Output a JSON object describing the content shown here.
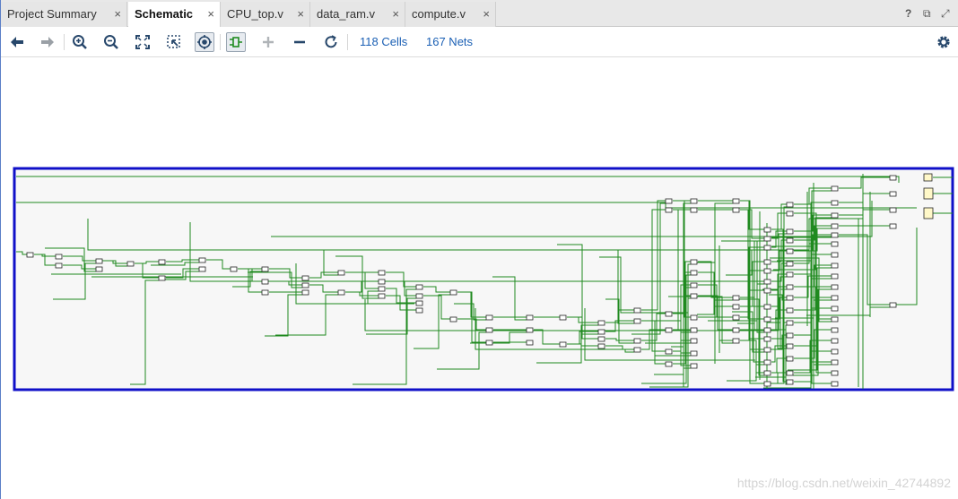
{
  "tabs": [
    {
      "label": "Project Summary",
      "active": false
    },
    {
      "label": "Schematic",
      "active": true
    },
    {
      "label": "CPU_top.v",
      "active": false
    },
    {
      "label": "data_ram.v",
      "active": false
    },
    {
      "label": "compute.v",
      "active": false
    }
  ],
  "tab_close_glyph": "×",
  "window_controls": {
    "help": "?",
    "restore": "⧉",
    "maximize": "⤢"
  },
  "toolbar": {
    "icons": [
      "back-arrow-icon",
      "forward-arrow-icon",
      "zoom-in-icon",
      "zoom-out-icon",
      "zoom-fit-icon",
      "zoom-area-icon",
      "auto-fit-selection-icon",
      "route-nets-icon",
      "expand-plus-icon",
      "collapse-minus-icon",
      "refresh-icon",
      "gear-icon"
    ],
    "cells_label": "118 Cells",
    "nets_label": "167 Nets"
  },
  "watermark": "https://blog.csdn.net/weixin_42744892",
  "colors": {
    "wire": "#1f8a1f",
    "border": "#1010c8",
    "accent": "#1a5fb4"
  }
}
